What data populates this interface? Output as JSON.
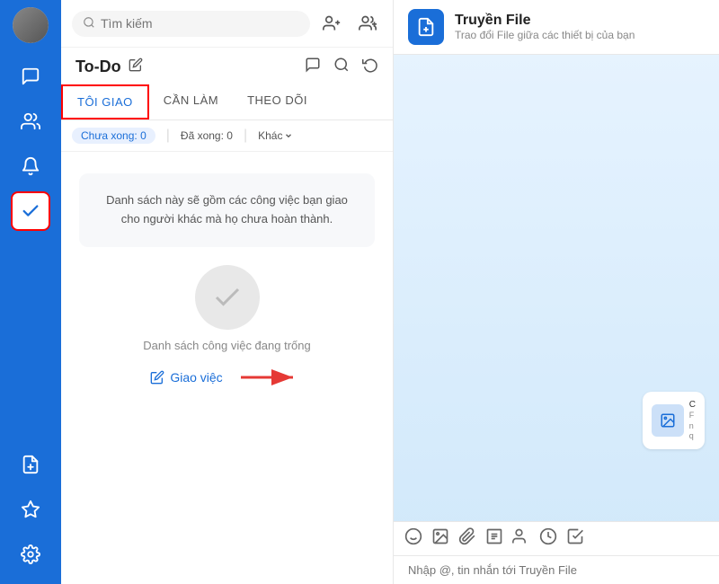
{
  "sidebar": {
    "icons": [
      {
        "name": "chat-icon",
        "symbol": "💬",
        "active": false
      },
      {
        "name": "contacts-icon",
        "symbol": "👤",
        "active": false
      },
      {
        "name": "bell-icon",
        "symbol": "🔔",
        "active": false
      },
      {
        "name": "todo-icon",
        "symbol": "✔",
        "active": true
      },
      {
        "name": "file-icon",
        "symbol": "➡",
        "active": false
      },
      {
        "name": "star-icon",
        "symbol": "☆",
        "active": false
      }
    ],
    "bottom_icon": {
      "name": "settings-icon",
      "symbol": "⚙"
    }
  },
  "search": {
    "placeholder": "Tìm kiếm"
  },
  "todo": {
    "title": "To-Do",
    "tabs": [
      {
        "label": "TÔI GIAO",
        "active": true
      },
      {
        "label": "CẦN LÀM",
        "active": false
      },
      {
        "label": "THEO DÕI",
        "active": false
      }
    ],
    "filter": {
      "pending": "Chưa xong: 0",
      "done": "Đã xong: 0",
      "other": "Khác"
    },
    "empty_card_text": "Danh sách này sẽ gồm các công việc bạn giao cho người khác mà họ chưa hoàn thành.",
    "empty_label": "Danh sách công việc đang trống",
    "assign_btn": "Giao việc"
  },
  "right": {
    "header": {
      "title": "Truyền File",
      "subtitle": "Trao đổi File giữa các thiết bị của bạn"
    },
    "input_placeholder": "Nhập @, tin nhắn tới Truyền File"
  }
}
